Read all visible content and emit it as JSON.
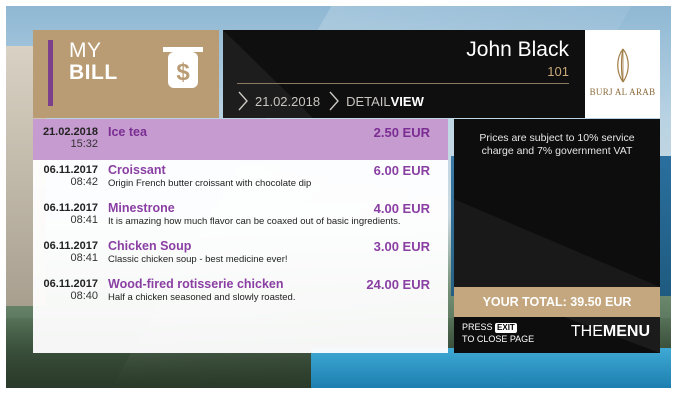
{
  "header": {
    "title_line1": "MY",
    "title_line2": "BILL",
    "bill_icon": "dollar-receipt-icon"
  },
  "guest": {
    "name": "John Black",
    "room": "101",
    "breadcrumb_date": "21.02.2018",
    "breadcrumb_view_prefix": "DETAIL",
    "breadcrumb_view_bold": "VIEW"
  },
  "logo": {
    "text": "BURJ AL ARAB"
  },
  "items": [
    {
      "date": "21.02.2018",
      "time": "15:32",
      "name": "Ice tea",
      "desc": "",
      "price": "2.50 EUR",
      "selected": true
    },
    {
      "date": "06.11.2017",
      "time": "08:42",
      "name": "Croissant",
      "desc": "Origin French butter croissant with chocolate dip",
      "price": "6.00 EUR"
    },
    {
      "date": "06.11.2017",
      "time": "08:41",
      "name": "Minestrone",
      "desc": "It is amazing how much flavor can be coaxed out of basic ingredients.",
      "price": "4.00 EUR"
    },
    {
      "date": "06.11.2017",
      "time": "08:41",
      "name": "Chicken Soup",
      "desc": "Classic chicken soup - best medicine ever!",
      "price": "3.00 EUR"
    },
    {
      "date": "06.11.2017",
      "time": "08:40",
      "name": "Wood-fired rotisserie chicken",
      "desc": "Half a chicken seasoned and slowly roasted.",
      "price": "24.00 EUR"
    }
  ],
  "info": {
    "note": "Prices are subject to 10% service charge and 7% government VAT"
  },
  "total": {
    "label": "YOUR TOTAL: 39.50 EUR"
  },
  "footer": {
    "press": "PRESS",
    "key": "EXIT",
    "close_text": "TO CLOSE PAGE",
    "brand_light": "THE",
    "brand_bold": "MENU"
  },
  "colors": {
    "accent_purple": "#8a3fa3",
    "gold": "#b99c74",
    "dark": "#0f0f10"
  }
}
